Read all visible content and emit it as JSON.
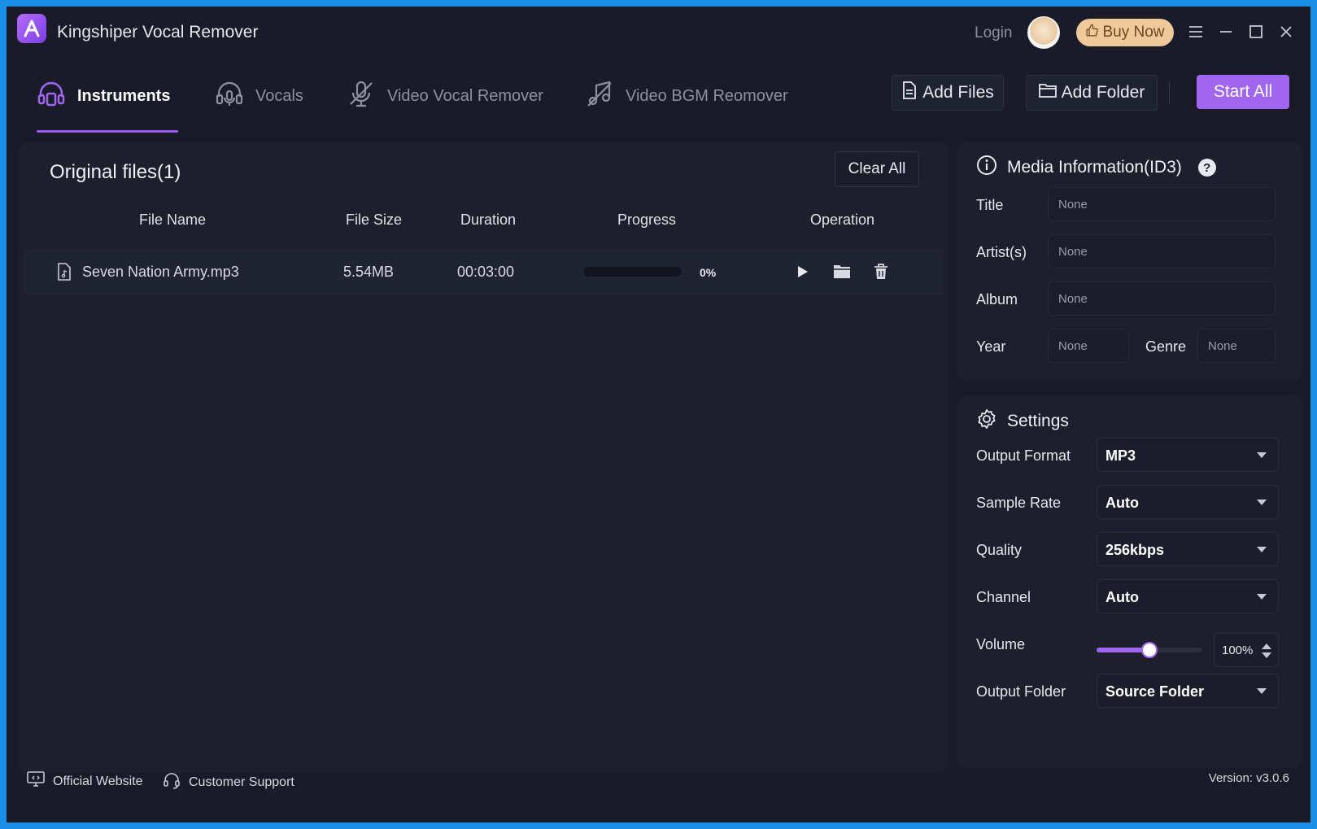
{
  "app": {
    "title": "Kingshiper Vocal Remover",
    "logo_icon": "app-logo-icon"
  },
  "titlebar": {
    "login": "Login",
    "buy_now": "Buy Now"
  },
  "tabs": [
    {
      "label": "Instruments",
      "icon": "headphones-icon",
      "active": true
    },
    {
      "label": "Vocals",
      "icon": "headphones-mic-icon",
      "active": false
    },
    {
      "label": "Video Vocal Remover",
      "icon": "mic-off-icon",
      "active": false
    },
    {
      "label": "Video BGM Reomover",
      "icon": "music-off-icon",
      "active": false
    }
  ],
  "toolbar": {
    "add_files": "Add Files",
    "add_folder": "Add Folder",
    "start_all": "Start All"
  },
  "files_panel": {
    "title": "Original files(1)",
    "clear_all": "Clear All",
    "columns": [
      "File Name",
      "File Size",
      "Duration",
      "Progress",
      "Operation"
    ],
    "rows": [
      {
        "file_name": "Seven Nation Army.mp3",
        "file_size": "5.54MB",
        "duration": "00:03:00",
        "progress": 0,
        "progress_label": "0%"
      }
    ]
  },
  "media_info": {
    "title": "Media Information(ID3)",
    "fields": {
      "title_label": "Title",
      "title_value": "None",
      "artist_label": "Artist(s)",
      "artist_value": "None",
      "album_label": "Album",
      "album_value": "None",
      "year_label": "Year",
      "year_value": "None",
      "genre_label": "Genre",
      "genre_value": "None"
    }
  },
  "settings": {
    "title": "Settings",
    "output_format_label": "Output Format",
    "output_format": "MP3",
    "sample_rate_label": "Sample Rate",
    "sample_rate": "Auto",
    "quality_label": "Quality",
    "quality": "256kbps",
    "channel_label": "Channel",
    "channel": "Auto",
    "volume_label": "Volume",
    "volume": 100,
    "volume_text": "100%",
    "volume_slider_fraction": 0.5,
    "output_folder_label": "Output Folder",
    "output_folder": "Source Folder"
  },
  "footer": {
    "official_website": "Official Website",
    "customer_support": "Customer Support",
    "version": "Version: v3.0.6"
  },
  "colors": {
    "accent": "#a066f0",
    "background": "#191b28",
    "panel": "#1d1f2d",
    "buy_now": "#f0c99a",
    "frame": "#1a8fe6"
  }
}
